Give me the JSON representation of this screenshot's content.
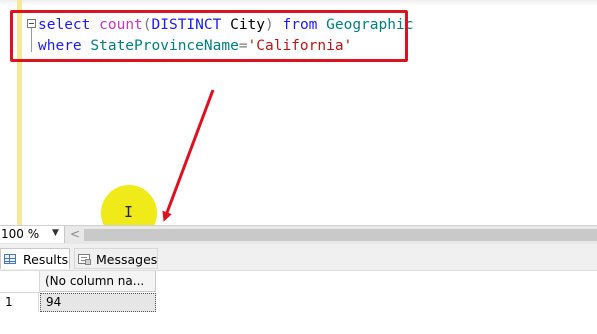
{
  "editor": {
    "line1": {
      "select": "select",
      "count": "count",
      "open_paren": "(",
      "distinct": "DISTINCT",
      "city": "City",
      "close_paren": ")",
      "from": "from",
      "table": "Geographic"
    },
    "line2": {
      "where": "where",
      "column": "StateProvinceName",
      "equals": "=",
      "value": "'California'"
    }
  },
  "status_bar": {
    "zoom_value": "100 %",
    "zoom_dropdown_icon": "chevron-down-icon",
    "scroll_left_icon": "chevron-left-icon",
    "scroll_left_glyph": "<"
  },
  "results_tabs": [
    {
      "label": "Results",
      "icon": "grid-icon",
      "active": true
    },
    {
      "label": "Messages",
      "icon": "message-icon",
      "active": false
    }
  ],
  "results_grid": {
    "columns": [
      "(No column na..."
    ],
    "rows": [
      {
        "row_number": "1",
        "cells": [
          "94"
        ]
      }
    ]
  },
  "colors": {
    "highlight_box": "#e0101e",
    "arrow": "#e0101e",
    "cursor_highlight": "#f0e800",
    "keyword": "#1a1aff",
    "function": "#d030d0",
    "object": "#008080",
    "string": "#c81414"
  }
}
